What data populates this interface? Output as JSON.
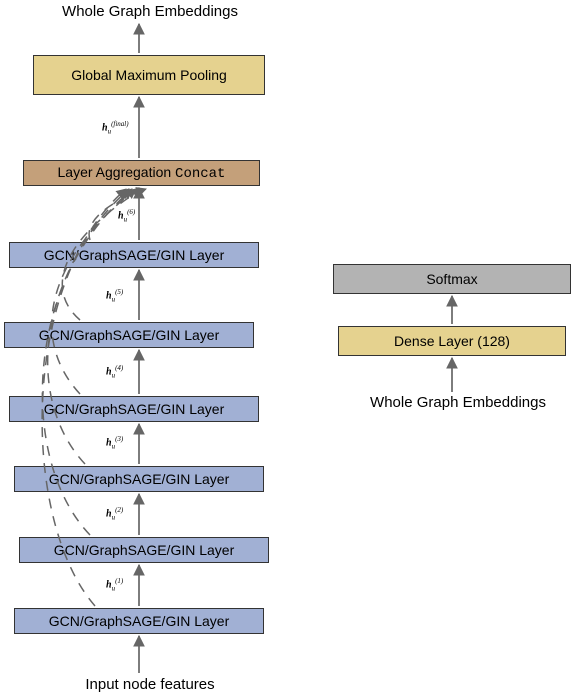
{
  "left": {
    "top_label": "Whole Graph Embeddings",
    "pooling": "Global Maximum Pooling",
    "agg_prefix": "Layer Aggregation ",
    "agg_suffix": "Concat",
    "gnn_layers": [
      "GCN/GraphSAGE/GIN Layer",
      "GCN/GraphSAGE/GIN Layer",
      "GCN/GraphSAGE/GIN Layer",
      "GCN/GraphSAGE/GIN Layer",
      "GCN/GraphSAGE/GIN Layer",
      "GCN/GraphSAGE/GIN Layer"
    ],
    "input_label": "Input node features",
    "h_labels": [
      "h_u^{(1)}",
      "h_u^{(2)}",
      "h_u^{(3)}",
      "h_u^{(4)}",
      "h_u^{(5)}",
      "h_u^{(6)}",
      "h_u^{(final)}"
    ]
  },
  "right": {
    "softmax": "Softmax",
    "dense": "Dense Layer (128)",
    "bottom_label": "Whole Graph Embeddings"
  },
  "chart_data": {
    "type": "diagram",
    "title": "GNN architecture with layer aggregation and readout + classification head",
    "left_stack": [
      {
        "name": "Input node features",
        "type": "input"
      },
      {
        "name": "GCN/GraphSAGE/GIN Layer",
        "out": "h_u^{(1)}"
      },
      {
        "name": "GCN/GraphSAGE/GIN Layer",
        "out": "h_u^{(2)}"
      },
      {
        "name": "GCN/GraphSAGE/GIN Layer",
        "out": "h_u^{(3)}"
      },
      {
        "name": "GCN/GraphSAGE/GIN Layer",
        "out": "h_u^{(4)}"
      },
      {
        "name": "GCN/GraphSAGE/GIN Layer",
        "out": "h_u^{(5)}"
      },
      {
        "name": "GCN/GraphSAGE/GIN Layer",
        "out": "h_u^{(6)}"
      },
      {
        "name": "Layer Aggregation Concat",
        "type": "concat",
        "inputs": [
          "h_u^{(1)}",
          "h_u^{(2)}",
          "h_u^{(3)}",
          "h_u^{(4)}",
          "h_u^{(5)}",
          "h_u^{(6)}"
        ],
        "out": "h_u^{(final)}"
      },
      {
        "name": "Global Maximum Pooling",
        "type": "readout"
      },
      {
        "name": "Whole Graph Embeddings",
        "type": "output"
      }
    ],
    "right_stack": [
      {
        "name": "Whole Graph Embeddings",
        "type": "input"
      },
      {
        "name": "Dense Layer (128)",
        "type": "dense",
        "units": 128
      },
      {
        "name": "Softmax",
        "type": "softmax"
      }
    ],
    "skip_connections": "every GNN layer output feeds into Layer Aggregation Concat"
  }
}
